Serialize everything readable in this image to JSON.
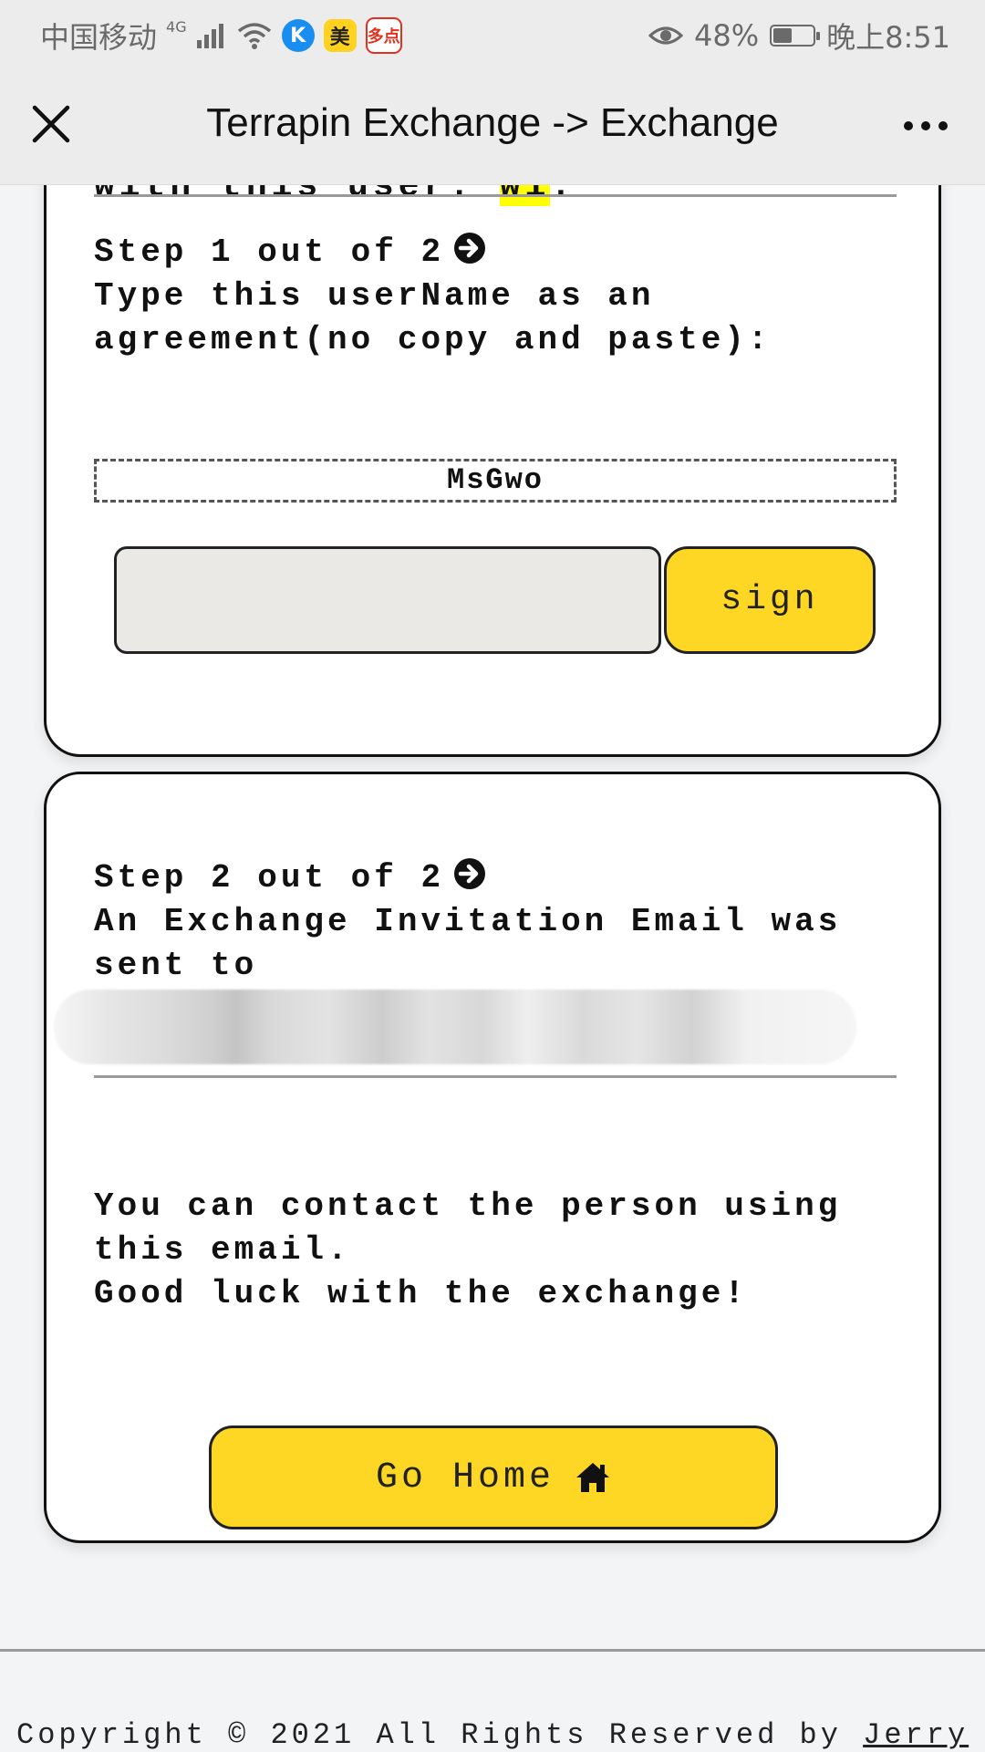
{
  "status_bar": {
    "carrier": "中国移动",
    "network": "4G",
    "app_badges": [
      "K",
      "美",
      "多点"
    ],
    "battery_percent": "48%",
    "battery_level": 0.48,
    "time": "晚上8:51"
  },
  "title_bar": {
    "title": "Terrapin Exchange -> Exchange"
  },
  "card1": {
    "clipped_text": "with this user: ",
    "clipped_highlight": "wi",
    "clipped_end": ".",
    "step_label": "Step 1 out of 2",
    "instruction": "Type this userName as an\nagreement(no copy and paste):",
    "username": "MsGwo",
    "input_value": "",
    "sign_label": "sign"
  },
  "card2": {
    "step_label": "Step 2 out of 2",
    "sent_text": "An Exchange Invitation Email was\nsent to",
    "message_line1": "You can contact the person using",
    "message_line2": "this email.",
    "message_line3": "Good luck with the exchange!",
    "home_label": "Go Home"
  },
  "footer": {
    "copyright": "Copyright © 2021 All Rights Reserved by ",
    "author": "Jerry"
  },
  "colors": {
    "accent": "#fed724",
    "card_border": "#111111",
    "background": "#f3f4f6"
  },
  "icons": {
    "close": "close-icon",
    "more": "more-icon",
    "step_arrow": "arrow-circle-right-icon",
    "home": "home-icon"
  }
}
